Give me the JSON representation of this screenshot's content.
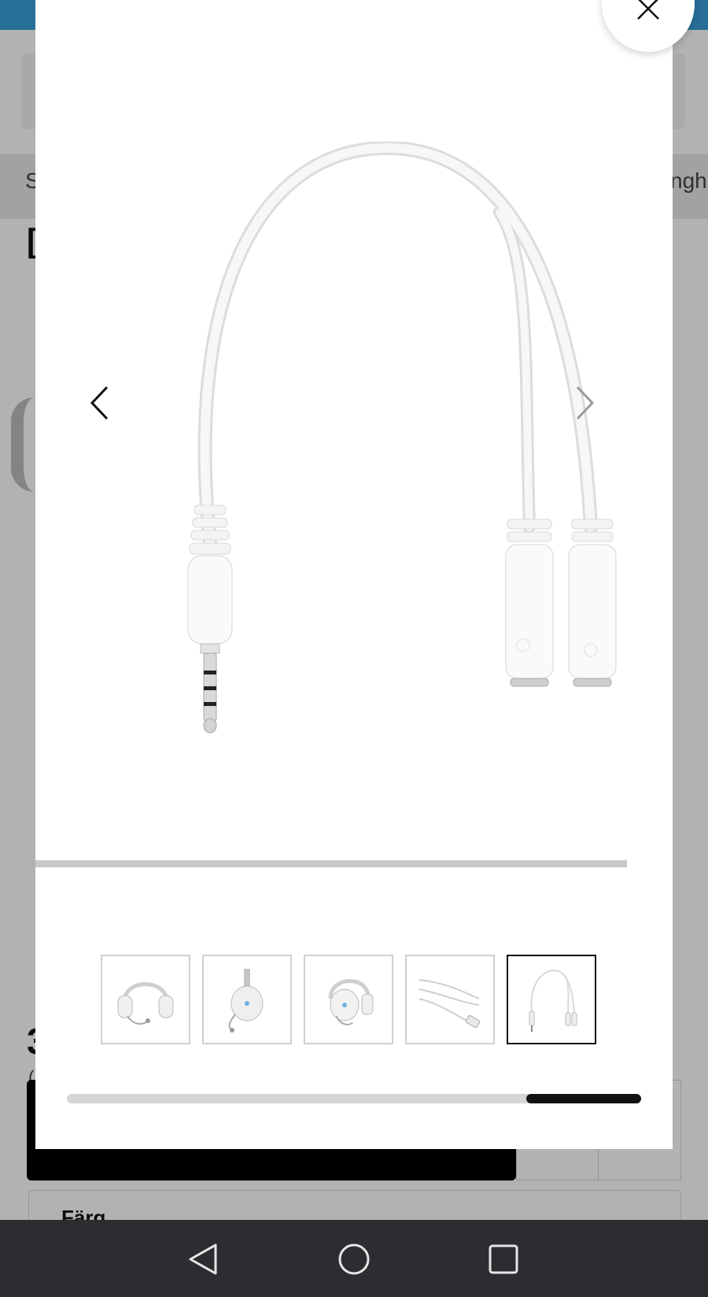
{
  "background": {
    "strip_left_text": "S",
    "strip_right_text": "ngh",
    "heading_fragment": "[",
    "price_fragment": "3",
    "sub_fragment": "(",
    "color_label": "Färg"
  },
  "modal": {
    "main_image": "y-splitter-cable-white",
    "prev_icon": "chevron-left-icon",
    "next_icon": "chevron-right-icon",
    "close_icon": "close-icon",
    "thumbnails": [
      {
        "name": "headset-front",
        "active": false
      },
      {
        "name": "headset-side-mic",
        "active": false
      },
      {
        "name": "headset-angle",
        "active": false
      },
      {
        "name": "cables",
        "active": false
      },
      {
        "name": "y-splitter-cable",
        "active": true
      }
    ],
    "scroll_position": 0.8
  },
  "system_nav": {
    "back_icon": "back-triangle-icon",
    "home_icon": "home-circle-icon",
    "recents_icon": "recents-square-icon"
  },
  "colors": {
    "accent_blue": "#3aa0d8",
    "nav_bar": "#2c2d30",
    "active_border": "#111111"
  }
}
